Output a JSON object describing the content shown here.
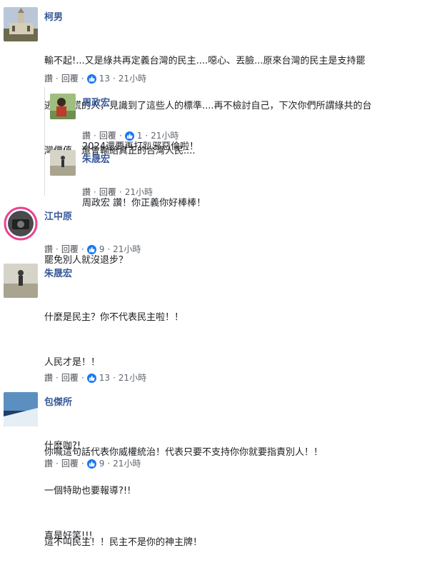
{
  "actions": {
    "like": "讚",
    "reply": "回覆",
    "sep": "·"
  },
  "colors": {
    "name": "#385898",
    "like_badge": "#1877f2",
    "meta": "#606770"
  },
  "comments": [
    {
      "name": "柯男",
      "lines": [
        "輸不起!...又是綠共再定義台灣的民主....噁心、丟臉...原來台灣的民主是支持罷",
        "逃、說謊的人，見識到了這些人的標準....再不檢討自己，下次你們所謂綠共的台",
        "灣價值，還會輸給真正的台灣人民...."
      ],
      "likes": "13",
      "time": "21小時"
    },
    {
      "name": "周政宏",
      "lines": [
        "2024還要再打趴邪惡倫啦！"
      ],
      "likes": "1",
      "time": "21小時"
    },
    {
      "name": "朱晟宏",
      "lines": [
        "周政宏 讚！你正義你好棒棒！"
      ],
      "likes": "",
      "time": "21小時"
    },
    {
      "name": "江中原",
      "lines": [
        "罷免別人就沒退步？"
      ],
      "likes": "9",
      "time": "21小時"
    },
    {
      "name": "朱晟宏",
      "lines": [
        "什麼是民主？你不代表民主啦！！",
        "人民才是！！",
        "",
        "你喊這句話代表你威權統治！代表只要不支持你你就要指責別人！！",
        "",
        "這不叫民主！！民主不是你的神主牌！"
      ],
      "likes": "13",
      "time": "21小時"
    },
    {
      "name": "包傑所",
      "lines": [
        "什麼咖?!",
        "一個特助也要報導?!!",
        "真是好笑!!!"
      ],
      "likes": "9",
      "time": "21小時"
    }
  ]
}
